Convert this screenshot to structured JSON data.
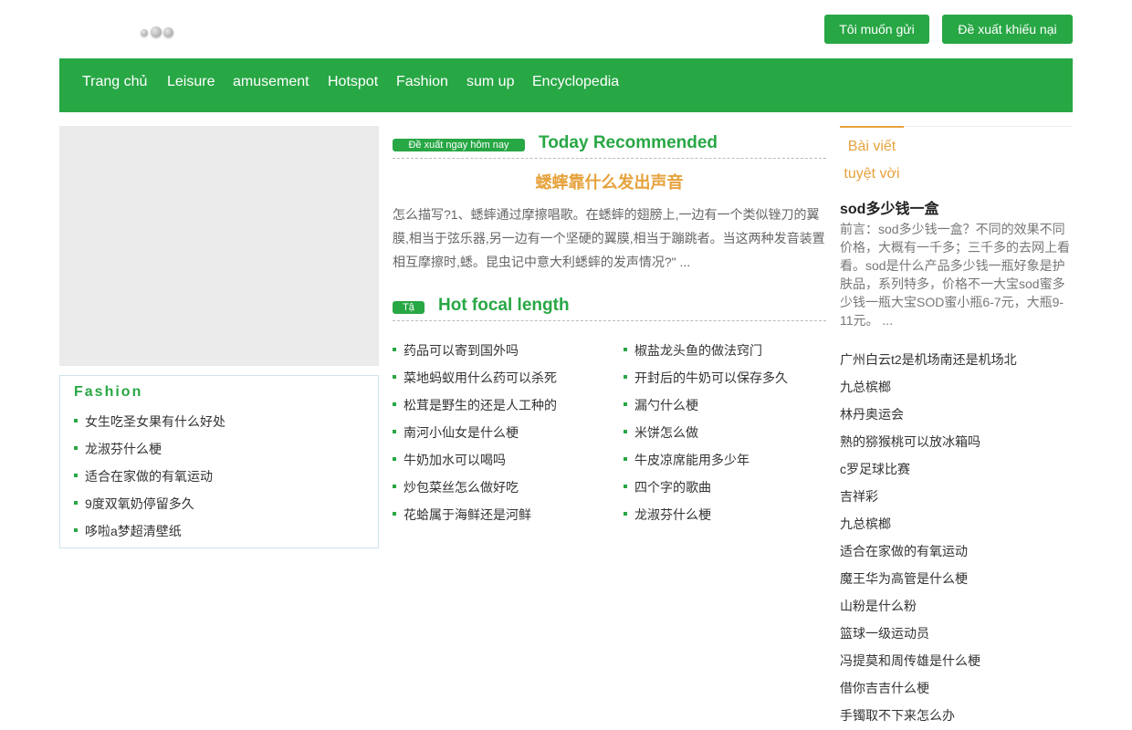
{
  "header": {
    "send_button": "Tôi muốn gửi",
    "complaint_button": "Đề xuất khiếu nại"
  },
  "nav": {
    "items": [
      "Trang chủ",
      "Leisure",
      "amusement",
      "Hotspot",
      "Fashion",
      "sum up",
      "Encyclopedia"
    ]
  },
  "left": {
    "fashion_title": "Fashion",
    "fashion_items": [
      "女生吃圣女果有什么好处",
      "龙淑芬什么梗",
      "适合在家做的有氧运动",
      "9度双氧奶停留多久",
      "哆啦a梦超清壁纸"
    ]
  },
  "recommended": {
    "tag": "Đề xuất ngay hôm nay",
    "title": "Today Recommended",
    "article_title": "蟋蟀靠什么发出声音",
    "article_excerpt": "怎么描写?1、蟋蟀通过摩擦唱歌。在蟋蟀的翅膀上,一边有一个类似锉刀的翼膜,相当于弦乐器,另一边有一个坚硬的翼膜,相当于蹦跳者。当这两种发音装置相互摩擦时,蟋。昆虫记中意大利蟋蟀的发声情况?\" ..."
  },
  "hot": {
    "tag": "Tậ",
    "title": "Hot focal length",
    "left_items": [
      "药品可以寄到国外吗",
      "菜地蚂蚁用什么药可以杀死",
      "松茸是野生的还是人工种的",
      "南河小仙女是什么梗",
      "牛奶加水可以喝吗",
      "炒包菜丝怎么做好吃",
      "花蛤属于海鲜还是河鲜"
    ],
    "right_items": [
      "椒盐龙头鱼的做法窍门",
      "开封后的牛奶可以保存多久",
      "漏勺什么梗",
      "米饼怎么做",
      "牛皮凉席能用多少年",
      "四个字的歌曲",
      "龙淑芬什么梗"
    ]
  },
  "sidebar": {
    "tab_line1": "Bài viết",
    "tab_line2": "tuyệt vời",
    "featured_title": "sod多少钱一盒",
    "featured_excerpt": "前言：sod多少钱一盒？不同的效果不同价格，大概有一千多；三千多的去网上看看。sod是什么产品多少钱一瓶好象是护肤品，系列特多，价格不一大宝sod蜜多少钱一瓶大宝SOD蜜小瓶6-7元，大瓶9-11元。 ...",
    "items": [
      "广州白云t2是机场南还是机场北",
      "九总槟榔",
      "林丹奥运会",
      "熟的猕猴桃可以放冰箱吗",
      "c罗足球比赛",
      "吉祥彩",
      "九总槟榔",
      "适合在家做的有氧运动",
      "魔王华为高管是什么梗",
      "山粉是什么粉",
      "篮球一级运动员",
      "冯提莫和周传雄是什么梗",
      "借你吉吉什么梗",
      "手镯取不下来怎么办"
    ]
  },
  "colors": {
    "brand_green": "#28a745",
    "accent_orange": "#e6a23c"
  }
}
